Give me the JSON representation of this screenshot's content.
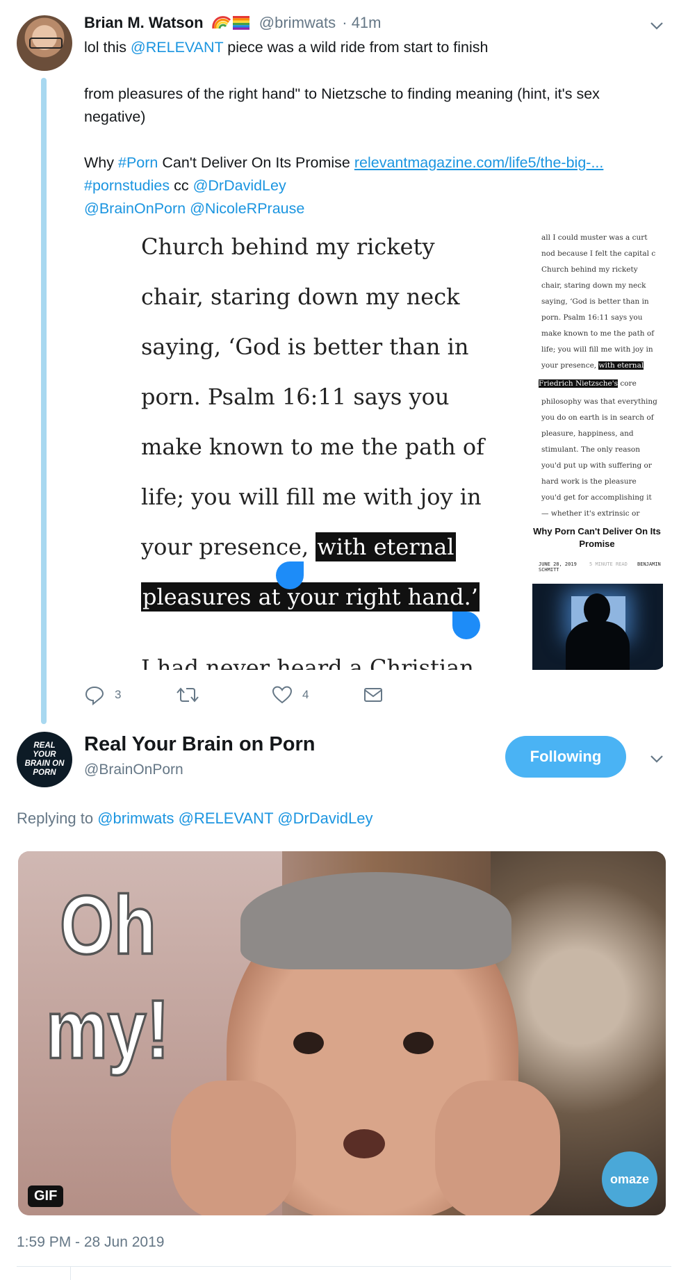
{
  "tweet1": {
    "name": "Brian M. Watson",
    "handle": "@brimwats",
    "time": "· 41m",
    "line1_pre": "lol this ",
    "line1_mention": "@RELEVANT",
    "line1_post": " piece was a wild ride from start to finish",
    "para2": "from pleasures of the right hand\" to Nietzsche to finding meaning (hint, it's sex negative)",
    "line3_pre": "Why ",
    "line3_hashtag": "#Porn",
    "line3_mid": " Can't Deliver On Its Promise ",
    "line3_link": "relevantmagazine.com/life5/the-big-...",
    "line4_hashtag": "#pornstudies",
    "line4_cc": " cc ",
    "line4_mention": "@DrDavidLey",
    "line5_mention1": "@BrainOnPorn",
    "line5_mention2": "@NicoleRPrause",
    "image_left_lines": [
      "Church behind my rickety",
      "chair, staring down my neck",
      "saying, ‘God is better than in",
      "porn. Psalm 16:11 says you",
      "make known to me the path of",
      "life; you will fill me with joy in",
      "your presence, ",
      "pleasures at your right hand.’",
      "I had never heard a Christian"
    ],
    "image_left_highlight": "with eternal",
    "image_right_lines": [
      "all I could muster was a curt",
      "nod because I felt the capital c",
      "Church behind my rickety",
      "chair, staring down my neck",
      "saying, ‘God is better than in",
      "porn. Psalm 16:11 says you",
      "make known to me the path of",
      "life; you will fill me with joy in",
      "your presence, ",
      "core",
      "philosophy was that everything",
      "you do on earth is in search of",
      "pleasure, happiness, and",
      "stimulant. The only reason",
      "you'd put up with suffering or",
      "hard work is the pleasure",
      "you'd get for accomplishing it",
      "— whether it's extrinsic or"
    ],
    "image_right_highlight1": "with eternal",
    "image_right_highlight2": "Friedrich Nietzsche's",
    "image_right_title": "Why Porn Can't Deliver On Its Promise",
    "image_right_date": "JUNE 28, 2019",
    "image_right_readtime": "5 MINUTE READ",
    "image_right_author": "BENJAMIN SCHMITT",
    "replies": "3",
    "likes": "4"
  },
  "tweet2": {
    "name": "Real Your Brain on Porn",
    "handle": "@BrainOnPorn",
    "avatar_text": "REAL YOUR BRAIN ON PORN",
    "follow_label": "Following",
    "replying_pre": "Replying to ",
    "replying_to": [
      "@brimwats",
      "@RELEVANT",
      "@DrDavidLey"
    ],
    "gif_text1": "Oh",
    "gif_text2": "my!",
    "gif_watermark": "omaze",
    "gif_badge": "GIF",
    "timestamp": "1:59 PM - 28 Jun 2019"
  },
  "colors": {
    "link": "#1b95e0",
    "follow_bg": "#4ab3f4",
    "muted": "#657786",
    "thread_line": "#a8d8f0"
  }
}
